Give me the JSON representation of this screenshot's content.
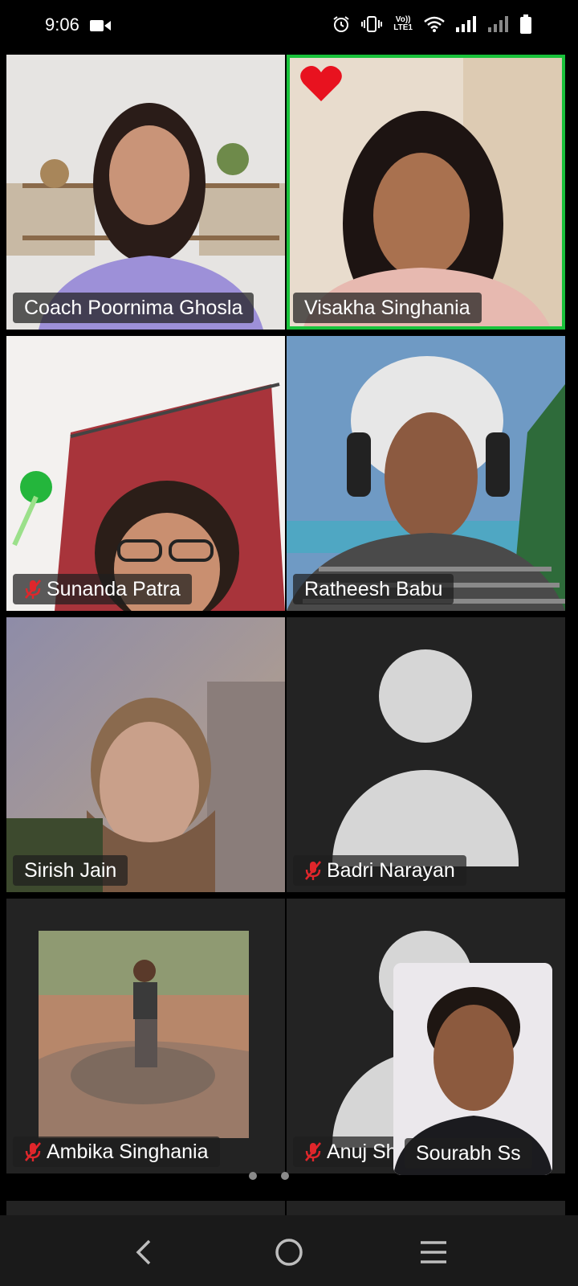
{
  "status_bar": {
    "time": "9:06",
    "volte_line1": "Vo))",
    "volte_line2": "LTE1"
  },
  "participants": [
    {
      "name": "Coach Poornima Ghosla",
      "muted": false
    },
    {
      "name": "Visakha Singhania",
      "muted": false,
      "active_speaker": true,
      "reaction": "heart-icon"
    },
    {
      "name": "Sunanda Patra",
      "muted": true
    },
    {
      "name": "Ratheesh Babu",
      "muted": false
    },
    {
      "name": "Sirish Jain",
      "muted": false
    },
    {
      "name": "Badri Narayan",
      "muted": true,
      "video_off": true
    },
    {
      "name": "Ambika Singhania",
      "muted": true,
      "video_off": true
    },
    {
      "name": "Anuj Sharma",
      "muted": true,
      "video_off": true
    }
  ],
  "self_view": {
    "name": "Sourabh Ss"
  },
  "colors": {
    "active_border": "#19c23b",
    "muted_icon": "#e0262b",
    "tile_bg": "#232323"
  }
}
